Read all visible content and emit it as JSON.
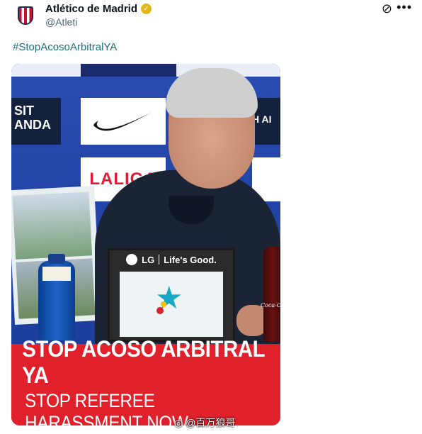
{
  "tweet": {
    "display_name": "Atlético de Madrid",
    "handle": "@Atleti",
    "hashtag": "#StopAcosoArbitralYA",
    "verified_icon": "verified-gold-badge-icon",
    "avatar_icon": "atletico-crest-icon"
  },
  "actions": {
    "grok_icon": "grok-icon",
    "more_icon": "more-options-icon"
  },
  "image": {
    "sponsor_left": "SIT\nANDA",
    "sponsor_right": "H AI",
    "laliga": "LALIGA",
    "screen_brand": "LG",
    "screen_slogan": "Life's Good.",
    "coke": "Coca-Cola",
    "banner_line1": "STOP ACOSO ARBITRAL YA",
    "banner_line2": "STOP REFEREE HARASSMENT NOW"
  },
  "watermark": {
    "text": "@百万狼哥"
  },
  "colors": {
    "hashtag": "#1b6f7a",
    "banner": "#e0202a",
    "verified": "#e2b719",
    "backdrop": "#1f3f9a"
  }
}
